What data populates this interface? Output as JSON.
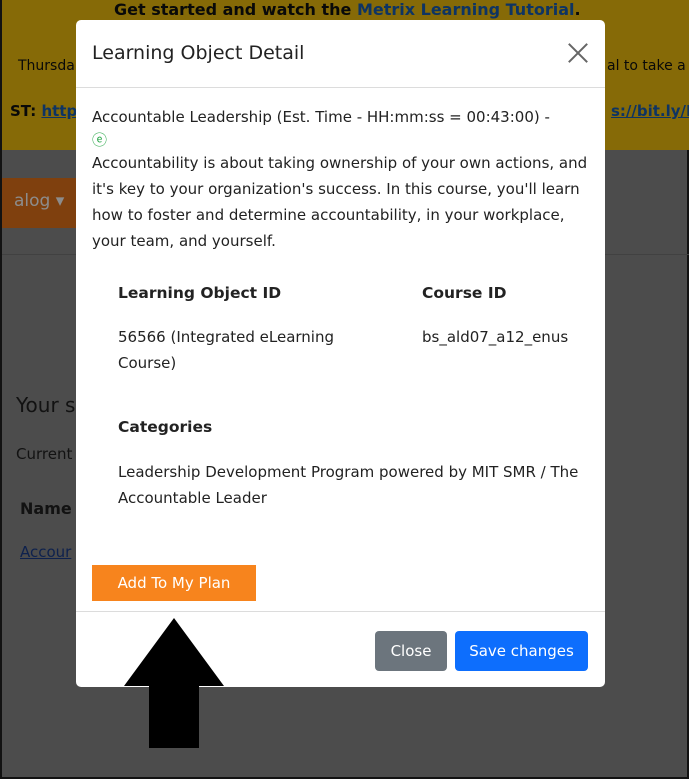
{
  "background": {
    "banner_line1_text": "Get started and watch the ",
    "banner_line1_link": "Metrix Learning Tutorial",
    "banner_line1_end": ".",
    "banner_line2_left": "Thursda",
    "banner_line2_right": "al to take a",
    "banner_line3_prefix": "ST: ",
    "banner_line3_link": "http",
    "banner_line3_right": "s://bit.ly/M",
    "catalog_button": "alog ▾",
    "your_text": "Your s",
    "current_text": "Current",
    "name_header": "Name",
    "row_link": "Accour"
  },
  "modal": {
    "title": "Learning Object Detail",
    "course_title": "Accountable Leadership (Est. Time - HH:mm:ss = 00:43:00) -",
    "elearning_icon": "e-learning-icon",
    "elearning_glyph": "ⓔ",
    "description": "Accountability is about taking ownership of your own actions, and it's key to your organization's success. In this course, you'll learn how to foster and determine accountability, in your workplace, your team, and yourself.",
    "learning_object_id_label": "Learning Object ID",
    "learning_object_id_value": "56566 (Integrated eLearning Course)",
    "course_id_label": "Course ID",
    "course_id_value": "bs_ald07_a12_enus",
    "categories_label": "Categories",
    "categories_value": "Leadership Development Program powered by MIT SMR / The Accountable Leader",
    "add_button": "Add To My Plan",
    "close_button": "Close",
    "save_button": "Save changes"
  },
  "colors": {
    "banner": "#f4c20d",
    "add_button": "#f7841d",
    "save_button": "#0d6efd",
    "close_button": "#6c757d",
    "elearning_icon": "#2aa84a"
  }
}
